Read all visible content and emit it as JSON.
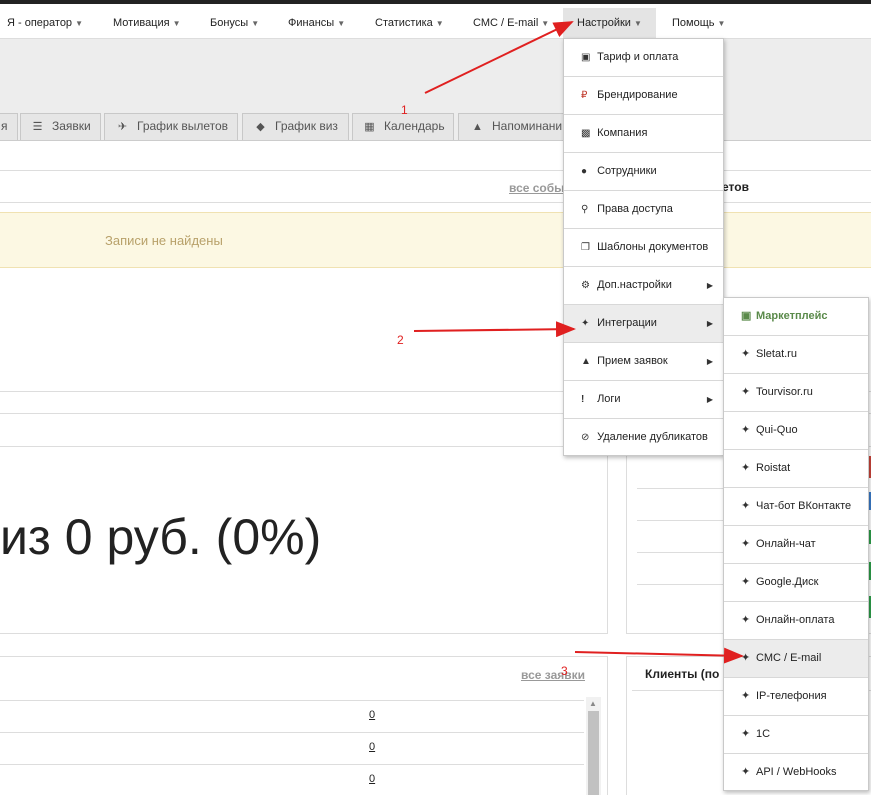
{
  "nav": {
    "items": [
      {
        "label": "Я - оператор"
      },
      {
        "label": "Мотивация"
      },
      {
        "label": "Бонусы"
      },
      {
        "label": "Финансы"
      },
      {
        "label": "Статистика"
      },
      {
        "label": "СМС / E-mail"
      },
      {
        "label": "Настройки"
      },
      {
        "label": "Помощь"
      }
    ]
  },
  "tabs": [
    {
      "label": "я",
      "icon": "none"
    },
    {
      "label": "Заявки",
      "icon": "list-icon"
    },
    {
      "label": "График вылетов",
      "icon": "plane-icon"
    },
    {
      "label": "График виз",
      "icon": "tag-icon"
    },
    {
      "label": "Календарь",
      "icon": "calendar-icon"
    },
    {
      "label": "Напоминани",
      "icon": "bell-icon"
    }
  ],
  "main": {
    "all_events_link": "все собы",
    "events_title_tail": "етов",
    "empty_message": "Записи не найдены",
    "big_summary": "из 0 руб. (0%)",
    "all_requests_link": "все заявки",
    "clients_title": "Клиенты (по",
    "row_values": [
      "0",
      "0",
      "0"
    ]
  },
  "settings_menu": {
    "items": [
      {
        "label": "Тариф и оплата",
        "icon": "money-icon",
        "has_submenu": false
      },
      {
        "label": "Брендирование",
        "icon": "ruble-icon",
        "has_submenu": false
      },
      {
        "label": "Компания",
        "icon": "building-icon",
        "has_submenu": false
      },
      {
        "label": "Сотрудники",
        "icon": "users-icon",
        "has_submenu": false
      },
      {
        "label": "Права доступа",
        "icon": "key-icon",
        "has_submenu": false
      },
      {
        "label": "Шаблоны документов",
        "icon": "copy-icon",
        "has_submenu": false
      },
      {
        "label": "Доп.настройки",
        "icon": "gear-icon",
        "has_submenu": true
      },
      {
        "label": "Интеграции",
        "icon": "plug-icon",
        "has_submenu": true
      },
      {
        "label": "Прием заявок",
        "icon": "sitemap-icon",
        "has_submenu": true
      },
      {
        "label": "Логи",
        "icon": "exclamation-icon",
        "has_submenu": true
      },
      {
        "label": "Удаление дубликатов",
        "icon": "ban-icon",
        "has_submenu": false
      }
    ]
  },
  "integrations_menu": {
    "items": [
      {
        "label": "Маркетплейс",
        "icon": "shopping-bag-icon"
      },
      {
        "label": "Sletat.ru",
        "icon": "plug-icon"
      },
      {
        "label": "Tourvisor.ru",
        "icon": "plug-icon"
      },
      {
        "label": "Qui-Quo",
        "icon": "plug-icon"
      },
      {
        "label": "Roistat",
        "icon": "plug-icon"
      },
      {
        "label": "Чат-бот ВКонтакте",
        "icon": "plug-icon"
      },
      {
        "label": "Онлайн-чат",
        "icon": "plug-icon"
      },
      {
        "label": "Google.Диск",
        "icon": "plug-icon"
      },
      {
        "label": "Онлайн-оплата",
        "icon": "plug-icon"
      },
      {
        "label": "СМС / E-mail",
        "icon": "plug-icon"
      },
      {
        "label": "IP-телефония",
        "icon": "plug-icon"
      },
      {
        "label": "1С",
        "icon": "plug-icon"
      },
      {
        "label": "API / WebHooks",
        "icon": "plug-icon"
      }
    ]
  },
  "annotations": {
    "labels": [
      "1",
      "2",
      "3"
    ],
    "color": "#e02020"
  },
  "colors": {
    "empty_bg": "#fcf8e3",
    "empty_text": "#b8a16a",
    "marketplace": "#5a8a4a",
    "active_nav_bg": "#e4e4e4"
  }
}
